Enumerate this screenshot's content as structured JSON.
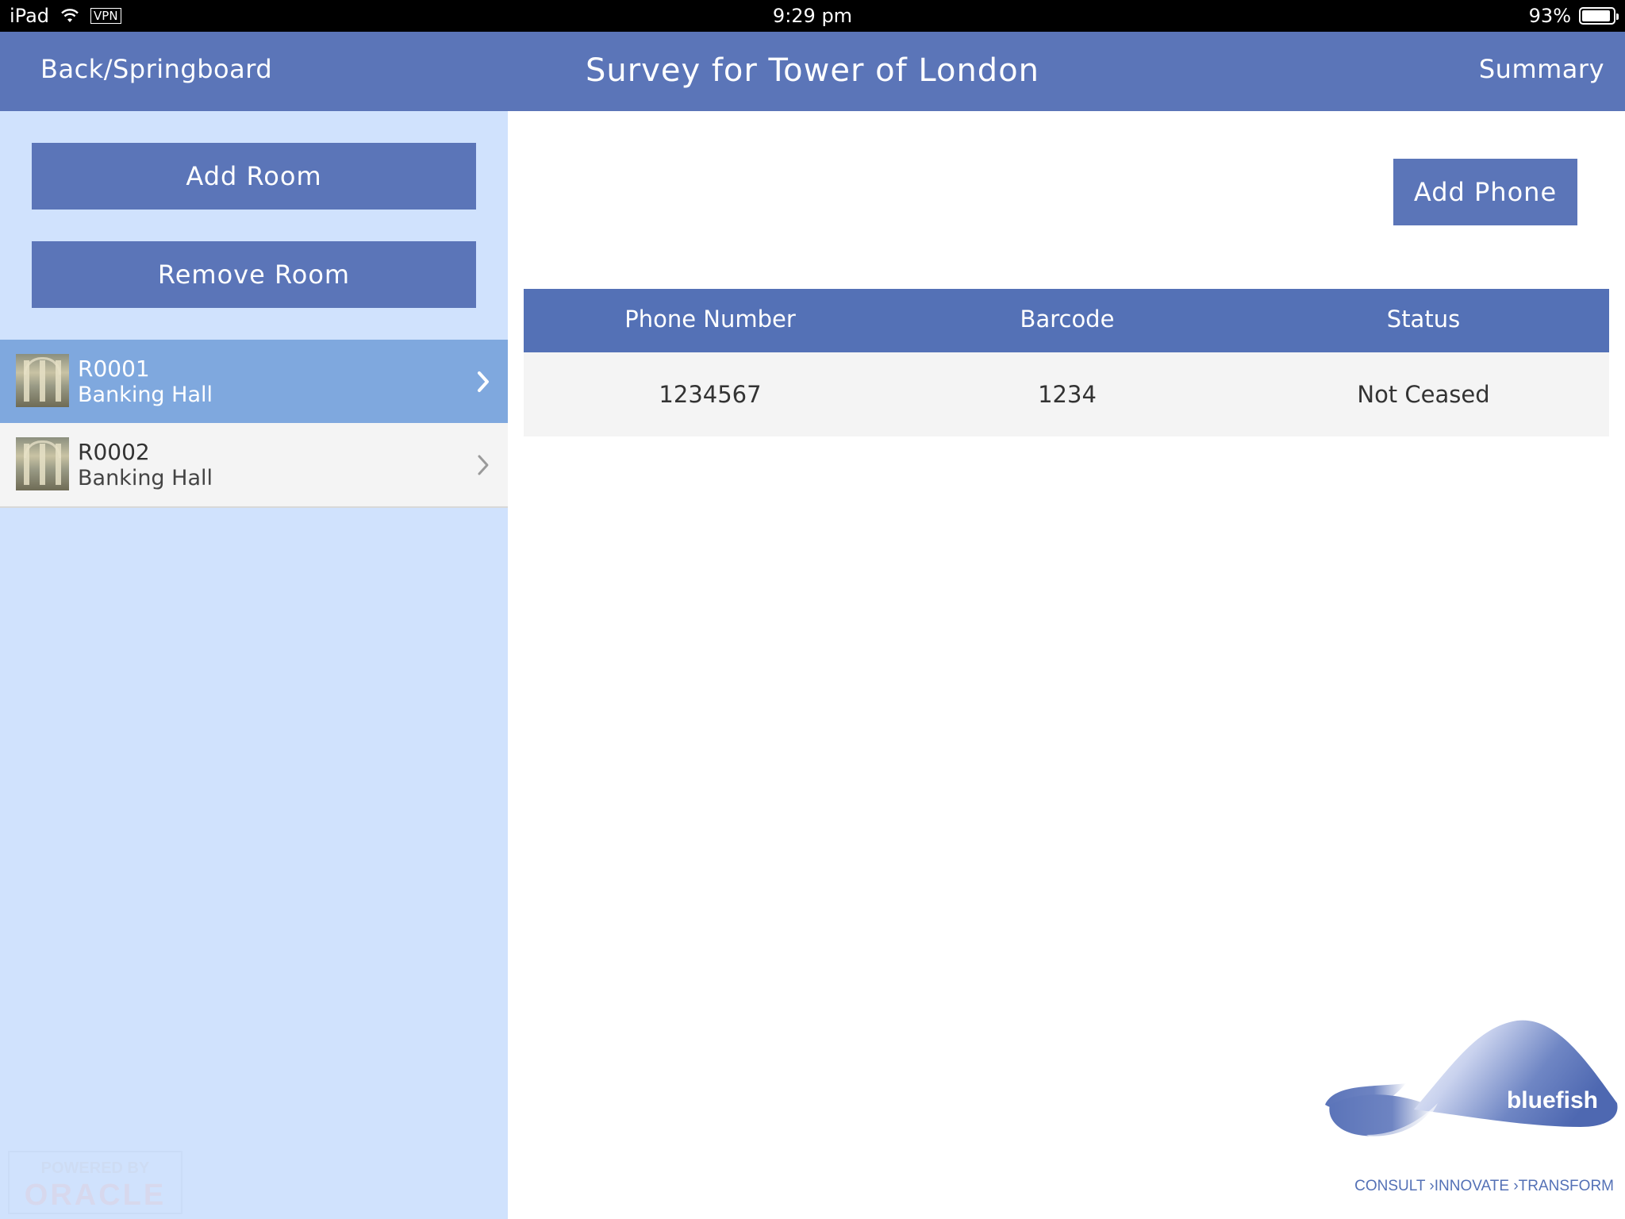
{
  "status_bar": {
    "device": "iPad",
    "vpn": "VPN",
    "time": "9:29 pm",
    "battery": "93%",
    "battery_level": 0.93
  },
  "nav": {
    "back_label": "Back/Springboard",
    "title": "Survey for Tower of London",
    "summary_label": "Summary"
  },
  "sidebar": {
    "add_room_label": "Add Room",
    "remove_room_label": "Remove Room",
    "rooms": [
      {
        "id": "R0001",
        "name": "Banking Hall",
        "selected": true
      },
      {
        "id": "R0002",
        "name": "Banking Hall",
        "selected": false
      }
    ],
    "powered_by": "POWERED BY",
    "powered_brand": "ORACLE"
  },
  "main": {
    "add_phone_label": "Add Phone",
    "table": {
      "headers": [
        "Phone Number",
        "Barcode",
        "Status"
      ],
      "rows": [
        [
          "1234567",
          "1234",
          "Not Ceased"
        ]
      ]
    }
  },
  "logo": {
    "brand": "bluefish",
    "tagline": "CONSULT ›INNOVATE ›TRANSFORM"
  },
  "colors": {
    "nav_bar": "#5b75b8",
    "sidebar_bg": "#d0e2fd",
    "selected_row": "#7fa8de",
    "table_header": "#5471b6",
    "table_row": "#f4f4f4"
  },
  "icons": [
    "wifi-icon",
    "battery-icon",
    "chevron-right-icon",
    "room-thumbnail"
  ]
}
